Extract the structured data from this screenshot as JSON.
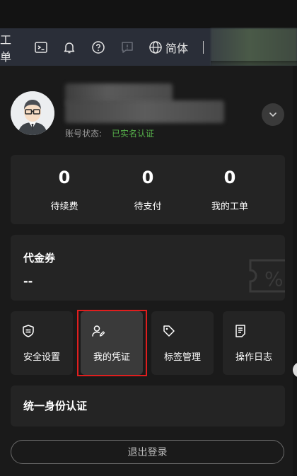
{
  "topbar": {
    "ticket_partial": "工单",
    "language": "简体"
  },
  "user": {
    "status_label": "账号状态:",
    "status_value": "已实名认证"
  },
  "stats": [
    {
      "value": "0",
      "label": "待续费"
    },
    {
      "value": "0",
      "label": "待支付"
    },
    {
      "value": "0",
      "label": "我的工单"
    }
  ],
  "voucher": {
    "title": "代金券",
    "value": "--"
  },
  "tiles": [
    {
      "label": "安全设置",
      "icon": "shield-settings-icon"
    },
    {
      "label": "我的凭证",
      "icon": "user-credential-icon"
    },
    {
      "label": "标签管理",
      "icon": "tag-icon"
    },
    {
      "label": "操作日志",
      "icon": "document-log-icon"
    }
  ],
  "sso": {
    "title": "统一身份认证"
  },
  "logout_label": "退出登录",
  "colors": {
    "background": "#1a1a1a",
    "card": "#242424",
    "topbar": "#2a2e38",
    "verified_green": "#56b04a",
    "highlight_red": "#e01e1e"
  }
}
